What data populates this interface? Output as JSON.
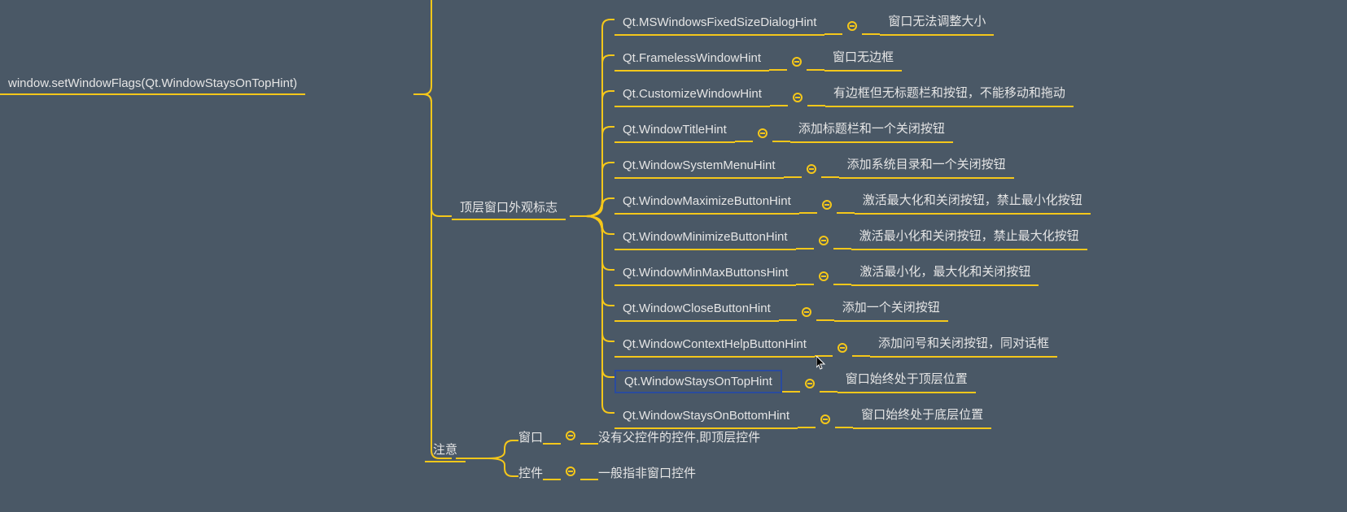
{
  "root": {
    "label": "window.setWindowFlags(Qt.WindowStaysOnTopHint)"
  },
  "categories": {
    "topflags": {
      "label": "顶层窗口外观标志"
    },
    "notes": {
      "label": "注意"
    }
  },
  "flags": [
    {
      "name": "Qt.MSWindowsFixedSizeDialogHint",
      "desc": "窗口无法调整大小",
      "selected": false
    },
    {
      "name": "Qt.FramelessWindowHint",
      "desc": "窗口无边框",
      "selected": false
    },
    {
      "name": "Qt.CustomizeWindowHint",
      "desc": "有边框但无标题栏和按钮，不能移动和拖动",
      "selected": false
    },
    {
      "name": "Qt.WindowTitleHint",
      "desc": "添加标题栏和一个关闭按钮",
      "selected": false
    },
    {
      "name": "Qt.WindowSystemMenuHint",
      "desc": "添加系统目录和一个关闭按钮",
      "selected": false
    },
    {
      "name": "Qt.WindowMaximizeButtonHint",
      "desc": "激活最大化和关闭按钮，禁止最小化按钮",
      "selected": false
    },
    {
      "name": "Qt.WindowMinimizeButtonHint",
      "desc": "激活最小化和关闭按钮，禁止最大化按钮",
      "selected": false
    },
    {
      "name": "Qt.WindowMinMaxButtonsHint",
      "desc": "激活最小化，最大化和关闭按钮",
      "selected": false
    },
    {
      "name": "Qt.WindowCloseButtonHint",
      "desc": "添加一个关闭按钮",
      "selected": false
    },
    {
      "name": "Qt.WindowContextHelpButtonHint",
      "desc": "添加问号和关闭按钮，同对话框",
      "selected": false
    },
    {
      "name": "Qt.WindowStaysOnTopHint",
      "desc": "窗口始终处于顶层位置",
      "selected": true
    },
    {
      "name": "Qt.WindowStaysOnBottomHint",
      "desc": "窗口始终处于底层位置",
      "selected": false
    }
  ],
  "notes_items": [
    {
      "name": "窗口",
      "desc": "没有父控件的控件,即顶层控件"
    },
    {
      "name": "控件",
      "desc": "一般指非窗口控件"
    }
  ],
  "colors": {
    "bg": "#4a5866",
    "line": "#f5c71a",
    "text": "#e5e5e5",
    "selected_border": "#2a4b9e"
  }
}
